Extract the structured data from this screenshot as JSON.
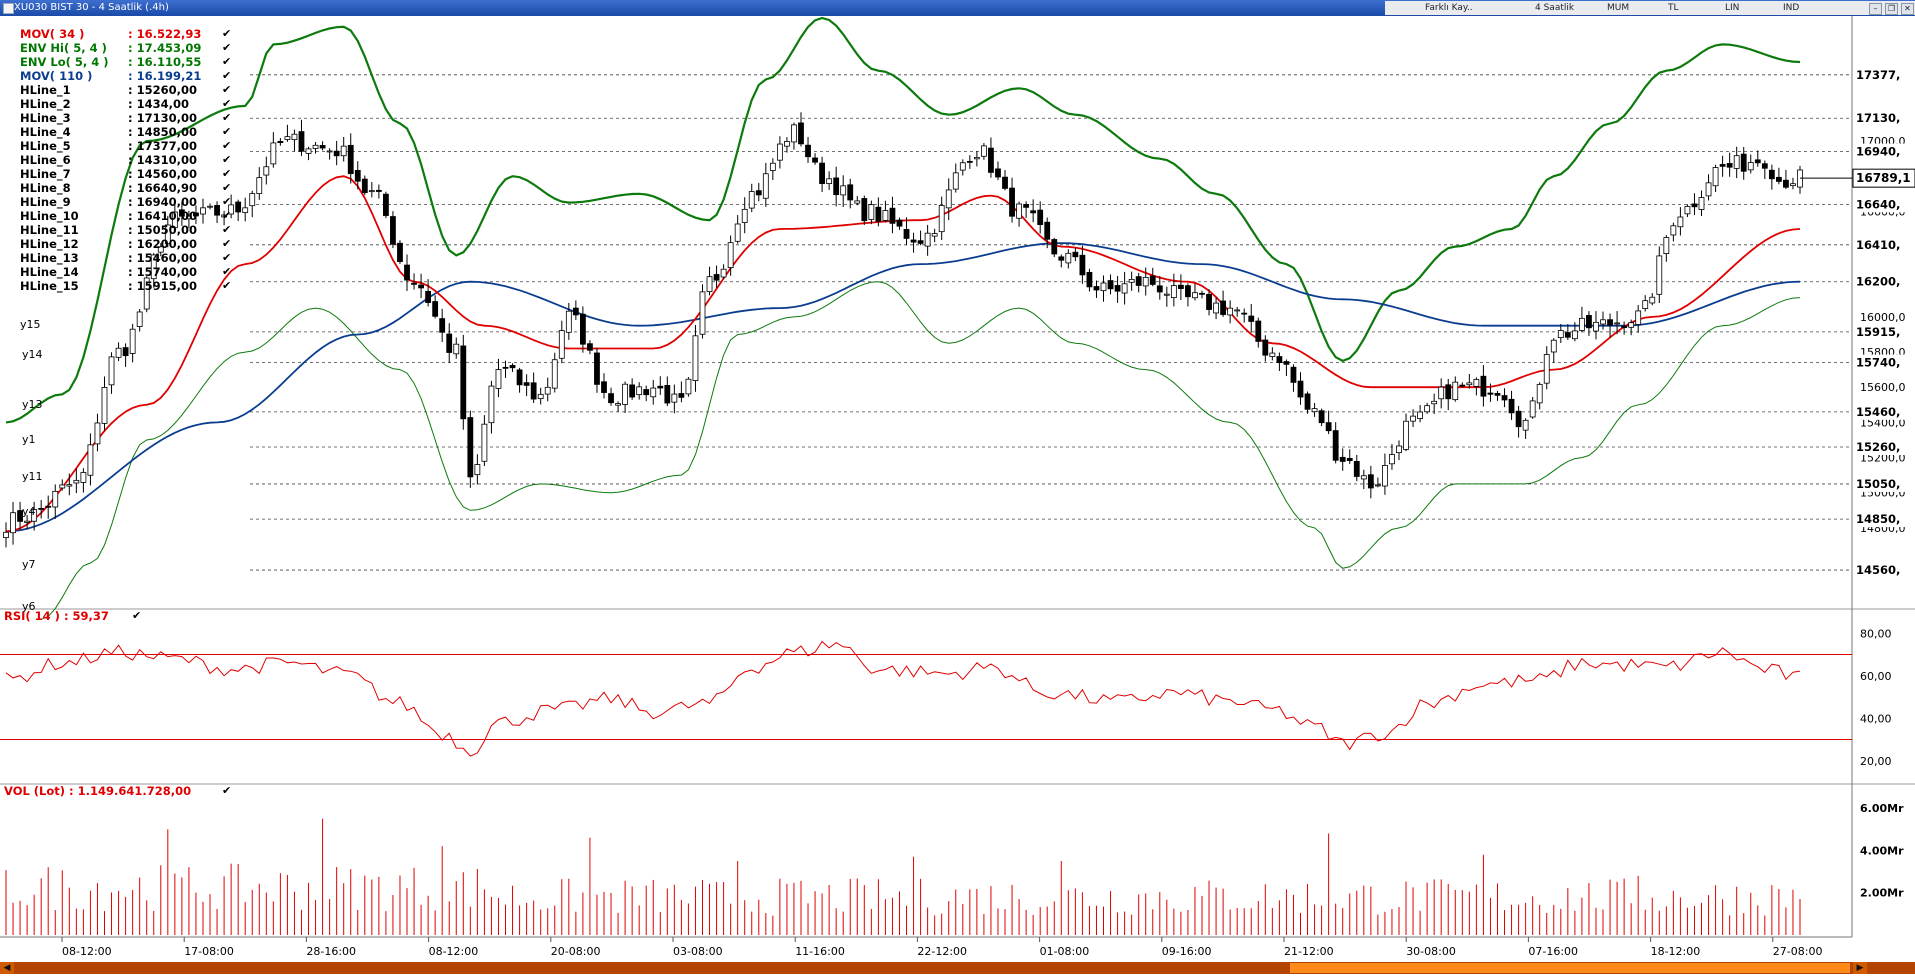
{
  "window": {
    "title": "XU030 BIST 30 - 4 Saatlik (.4h)",
    "toolbar": [
      "4 Saatlik",
      "MUM",
      "TL",
      "LIN",
      "IND"
    ],
    "toolbar_small": "Farklı Kay.."
  },
  "price_panel": {
    "legend": [
      {
        "name": "MOV( 34 )",
        "value": ": 16.522,93",
        "color": "#e00000"
      },
      {
        "name": "ENV Hi( 5, 4 )",
        "value": ": 17.453,09",
        "color": "#007700"
      },
      {
        "name": "ENV Lo( 5, 4 )",
        "value": ": 16.110,55",
        "color": "#007700"
      },
      {
        "name": "MOV( 110 )",
        "value": ": 16.199,21",
        "color": "#0a3d8f"
      },
      {
        "name": "HLine_1",
        "value": ": 15260,00",
        "color": "#000000"
      },
      {
        "name": "HLine_2",
        "value": ": 1434,00",
        "color": "#000000"
      },
      {
        "name": "HLine_3",
        "value": ": 17130,00",
        "color": "#000000"
      },
      {
        "name": "HLine_4",
        "value": ": 14850,00",
        "color": "#000000"
      },
      {
        "name": "HLine_5",
        "value": ": 17377,00",
        "color": "#000000"
      },
      {
        "name": "HLine_6",
        "value": ": 14310,00",
        "color": "#000000"
      },
      {
        "name": "HLine_7",
        "value": ": 14560,00",
        "color": "#000000"
      },
      {
        "name": "HLine_8",
        "value": ": 16640,90",
        "color": "#000000"
      },
      {
        "name": "HLine_9",
        "value": ": 16940,00",
        "color": "#000000"
      },
      {
        "name": "HLine_10",
        "value": ": 16410,00",
        "color": "#000000"
      },
      {
        "name": "HLine_11",
        "value": ": 15050,00",
        "color": "#000000"
      },
      {
        "name": "HLine_12",
        "value": ": 16200,00",
        "color": "#000000"
      },
      {
        "name": "HLine_13",
        "value": ": 15460,00",
        "color": "#000000"
      },
      {
        "name": "HLine_14",
        "value": ": 15740,00",
        "color": "#000000"
      },
      {
        "name": "HLine_15",
        "value": ": 15915,00",
        "color": "#000000"
      }
    ],
    "left_labels": [
      "y15",
      "y14",
      "y13",
      "y1",
      "y11",
      "y4",
      "y7",
      "y6"
    ]
  },
  "rsi_panel": {
    "label": "RSI( 14 ) : 59,37"
  },
  "vol_panel": {
    "label": "VOL (Lot) : 1.149.641.728,00"
  },
  "colors": {
    "candle_up": "#ffffff",
    "candle_down": "#000000",
    "mov34": "#e00000",
    "mov110": "#0a3d8f",
    "env": "#0d7a0d",
    "rsi": "#e00000",
    "vol": "#e00000",
    "hline": "#444444"
  },
  "chart_data": [
    {
      "type": "candlestick",
      "name": "price",
      "ylim": [
        14350,
        17700
      ],
      "yticks": [
        "17000,0",
        "16800,0",
        "16600,0",
        "16400,0",
        "16200,0",
        "16000,0",
        "15800,0",
        "15600,0",
        "15400,0",
        "15200,0",
        "15000,0",
        "14800,0"
      ],
      "ytick_values": [
        17000,
        16800,
        16600,
        16400,
        16200,
        16000,
        15800,
        15600,
        15400,
        15200,
        15000,
        14800
      ],
      "hlines": [
        {
          "value": 17377,
          "label": "17377,"
        },
        {
          "value": 17130,
          "label": "17130,"
        },
        {
          "value": 16940,
          "label": "16940,"
        },
        {
          "value": 16640,
          "label": "16640,"
        },
        {
          "value": 16410,
          "label": "16410,"
        },
        {
          "value": 16200,
          "label": "16200,"
        },
        {
          "value": 15915,
          "label": "15915,"
        },
        {
          "value": 15740,
          "label": "15740,"
        },
        {
          "value": 15460,
          "label": "15460,"
        },
        {
          "value": 15260,
          "label": "15260,"
        },
        {
          "value": 15050,
          "label": "15050,"
        },
        {
          "value": 14850,
          "label": "14850,"
        },
        {
          "value": 14560,
          "label": "14560,"
        }
      ],
      "last_price": {
        "value": 16789,
        "label": "16789,1"
      },
      "x_labels": [
        "08-12:00",
        "17-08:00",
        "28-16:00",
        "08-12:00",
        "20-08:00",
        "03-08:00",
        "11-16:00",
        "22-12:00",
        "01-08:00",
        "09-16:00",
        "21-12:00",
        "30-08:00",
        "07-16:00",
        "18-12:00",
        "27-08:00"
      ],
      "close_anchors": [
        [
          0,
          14830
        ],
        [
          3,
          14870
        ],
        [
          10,
          15050
        ],
        [
          16,
          15800
        ],
        [
          24,
          16550
        ],
        [
          32,
          16600
        ],
        [
          40,
          17000
        ],
        [
          47,
          16950
        ],
        [
          52,
          16700
        ],
        [
          58,
          16200
        ],
        [
          64,
          15800
        ],
        [
          66,
          15050
        ],
        [
          70,
          15700
        ],
        [
          76,
          15550
        ],
        [
          80,
          16000
        ],
        [
          86,
          15550
        ],
        [
          92,
          15600
        ],
        [
          96,
          15500
        ],
        [
          100,
          16200
        ],
        [
          106,
          16700
        ],
        [
          112,
          17050
        ],
        [
          116,
          16800
        ],
        [
          122,
          16600
        ],
        [
          130,
          16450
        ],
        [
          138,
          16950
        ],
        [
          144,
          16600
        ],
        [
          150,
          16350
        ],
        [
          156,
          16150
        ],
        [
          162,
          16200
        ],
        [
          168,
          16100
        ],
        [
          174,
          16050
        ],
        [
          180,
          15800
        ],
        [
          186,
          15450
        ],
        [
          190,
          15200
        ],
        [
          194,
          15050
        ],
        [
          200,
          15400
        ],
        [
          206,
          15600
        ],
        [
          212,
          15600
        ],
        [
          216,
          15400
        ],
        [
          220,
          15900
        ],
        [
          226,
          15950
        ],
        [
          232,
          16000
        ],
        [
          238,
          16600
        ],
        [
          244,
          16850
        ],
        [
          250,
          16900
        ],
        [
          252,
          16780
        ],
        [
          255,
          16789
        ]
      ],
      "mov34_anchors": [
        [
          0,
          14780
        ],
        [
          20,
          15500
        ],
        [
          34,
          16300
        ],
        [
          48,
          16800
        ],
        [
          58,
          16200
        ],
        [
          68,
          15950
        ],
        [
          80,
          15820
        ],
        [
          92,
          15820
        ],
        [
          110,
          16500
        ],
        [
          130,
          16550
        ],
        [
          140,
          16690
        ],
        [
          150,
          16400
        ],
        [
          168,
          16200
        ],
        [
          180,
          15850
        ],
        [
          194,
          15600
        ],
        [
          210,
          15600
        ],
        [
          220,
          15700
        ],
        [
          234,
          16000
        ],
        [
          255,
          16500
        ]
      ],
      "mov110_anchors": [
        [
          0,
          14780
        ],
        [
          30,
          15400
        ],
        [
          50,
          15900
        ],
        [
          66,
          16200
        ],
        [
          90,
          15950
        ],
        [
          110,
          16050
        ],
        [
          130,
          16300
        ],
        [
          150,
          16420
        ],
        [
          170,
          16300
        ],
        [
          190,
          16100
        ],
        [
          210,
          15950
        ],
        [
          230,
          15950
        ],
        [
          255,
          16200
        ]
      ],
      "env_hi_anchors": [
        [
          0,
          15400
        ],
        [
          8,
          15560
        ],
        [
          20,
          17000
        ],
        [
          34,
          17200
        ],
        [
          38,
          17550
        ],
        [
          48,
          17650
        ],
        [
          56,
          17100
        ],
        [
          64,
          16350
        ],
        [
          72,
          16800
        ],
        [
          80,
          16650
        ],
        [
          90,
          16700
        ],
        [
          100,
          16550
        ],
        [
          108,
          17350
        ],
        [
          116,
          17700
        ],
        [
          124,
          17400
        ],
        [
          134,
          17150
        ],
        [
          144,
          17300
        ],
        [
          152,
          17150
        ],
        [
          164,
          16900
        ],
        [
          172,
          16700
        ],
        [
          182,
          16300
        ],
        [
          190,
          15750
        ],
        [
          198,
          16150
        ],
        [
          206,
          16400
        ],
        [
          214,
          16500
        ],
        [
          220,
          16800
        ],
        [
          228,
          17100
        ],
        [
          236,
          17400
        ],
        [
          244,
          17550
        ],
        [
          255,
          17450
        ]
      ],
      "env_lo_anchors": [
        [
          5,
          14280
        ],
        [
          12,
          14600
        ],
        [
          20,
          15300
        ],
        [
          34,
          15800
        ],
        [
          44,
          16050
        ],
        [
          56,
          15700
        ],
        [
          66,
          14900
        ],
        [
          76,
          15050
        ],
        [
          86,
          15000
        ],
        [
          96,
          15100
        ],
        [
          104,
          15900
        ],
        [
          112,
          16000
        ],
        [
          124,
          16200
        ],
        [
          134,
          15850
        ],
        [
          144,
          16050
        ],
        [
          152,
          15850
        ],
        [
          162,
          15700
        ],
        [
          174,
          15400
        ],
        [
          186,
          14800
        ],
        [
          190,
          14570
        ],
        [
          198,
          14800
        ],
        [
          206,
          15050
        ],
        [
          216,
          15050
        ],
        [
          224,
          15200
        ],
        [
          232,
          15500
        ],
        [
          244,
          15950
        ],
        [
          255,
          16110
        ]
      ]
    },
    {
      "type": "line",
      "name": "RSI",
      "ylim": [
        10,
        90
      ],
      "yticks": [
        "80,00",
        "60,00",
        "40,00",
        "20,00"
      ],
      "ytick_values": [
        80,
        60,
        40,
        20
      ],
      "bands": [
        70,
        30
      ],
      "last": 59.37,
      "anchors": [
        [
          0,
          58
        ],
        [
          8,
          66
        ],
        [
          16,
          71
        ],
        [
          24,
          68
        ],
        [
          32,
          63
        ],
        [
          40,
          66
        ],
        [
          48,
          61
        ],
        [
          56,
          47
        ],
        [
          62,
          33
        ],
        [
          66,
          25
        ],
        [
          70,
          38
        ],
        [
          78,
          44
        ],
        [
          86,
          49
        ],
        [
          92,
          43
        ],
        [
          100,
          47
        ],
        [
          106,
          64
        ],
        [
          112,
          71
        ],
        [
          118,
          75
        ],
        [
          124,
          63
        ],
        [
          134,
          61
        ],
        [
          140,
          64
        ],
        [
          148,
          52
        ],
        [
          158,
          48
        ],
        [
          166,
          52
        ],
        [
          174,
          48
        ],
        [
          180,
          44
        ],
        [
          186,
          36
        ],
        [
          190,
          28
        ],
        [
          196,
          33
        ],
        [
          202,
          47
        ],
        [
          210,
          56
        ],
        [
          218,
          58
        ],
        [
          224,
          66
        ],
        [
          230,
          65
        ],
        [
          236,
          64
        ],
        [
          244,
          71
        ],
        [
          250,
          63
        ],
        [
          255,
          59
        ]
      ]
    },
    {
      "type": "bar",
      "name": "VOL",
      "ylim": [
        0,
        7000000000
      ],
      "yticks": [
        "6.00Mr",
        "4.00Mr",
        "2.00Mr"
      ],
      "ytick_values": [
        6000000000,
        4000000000,
        2000000000
      ],
      "last": 1149641728,
      "spikes": [
        [
          23,
          5000000000
        ],
        [
          45,
          5500000000
        ],
        [
          62,
          4200000000
        ],
        [
          83,
          4600000000
        ],
        [
          104,
          3500000000
        ],
        [
          129,
          3700000000
        ],
        [
          150,
          3500000000
        ],
        [
          188,
          4800000000
        ],
        [
          210,
          3800000000
        ],
        [
          232,
          2800000000
        ]
      ]
    }
  ]
}
